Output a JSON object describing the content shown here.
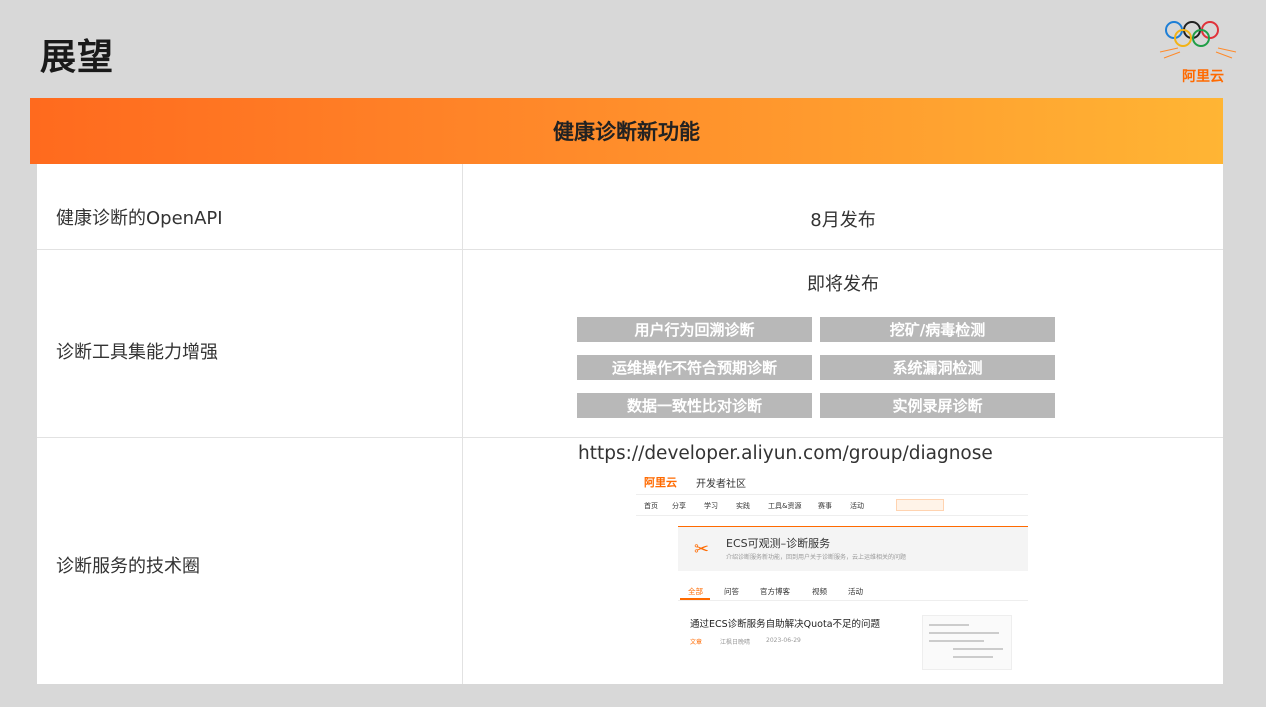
{
  "slide": {
    "title": "展望"
  },
  "logo": {
    "brand": "阿里云",
    "icon": "olympic-rings-icon"
  },
  "table": {
    "header": "健康诊断新功能",
    "rows": [
      {
        "feature": "健康诊断的OpenAPI",
        "detail": "8月发布"
      },
      {
        "feature": "诊断工具集能力增强",
        "detail": "即将发布"
      },
      {
        "feature": "诊断服务的技术圈",
        "detail": "https://developer.aliyun.com/group/diagnose"
      }
    ],
    "tags": [
      "用户行为回溯诊断",
      "挖矿/病毒检测",
      "运维操作不符合预期诊断",
      "系统漏洞检测",
      "数据一致性比对诊断",
      "实例录屏诊断"
    ]
  },
  "screenshot": {
    "brand": "阿里云",
    "site": "开发者社区",
    "nav": [
      "首页",
      "分享",
      "学习",
      "实践",
      "工具&资源",
      "赛事",
      "活动"
    ],
    "banner_title": "ECS可观测–诊断服务",
    "banner_desc": "介绍诊断服务新功能，回到用户关于诊断服务，云上运维相关的问题",
    "tabs": [
      "全部",
      "问答",
      "官方博客",
      "视频",
      "活动"
    ],
    "article_title": "通过ECS诊断服务自助解决Quota不足的问题",
    "article_meta": {
      "type": "文章",
      "author": "江枫日晚晴",
      "date": "2023-06-29"
    }
  },
  "colors": {
    "accent": "#ff6a00",
    "header_start": "#ff6a1e",
    "header_end": "#ffb534",
    "tag_bg": "#b8b8b8"
  }
}
